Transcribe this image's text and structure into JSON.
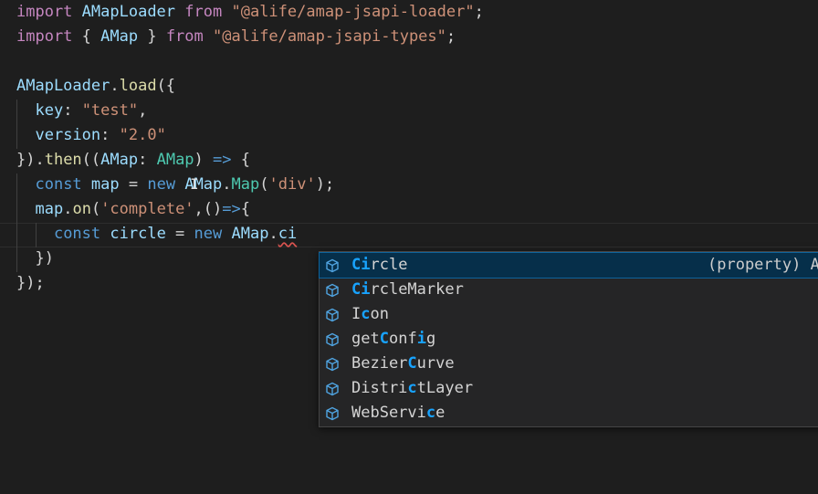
{
  "editor": {
    "lines": [
      [
        {
          "t": "import",
          "c": "kw"
        },
        {
          "t": " ",
          "c": "punc"
        },
        {
          "t": "AMapLoader",
          "c": "var"
        },
        {
          "t": " ",
          "c": "punc"
        },
        {
          "t": "from",
          "c": "kw"
        },
        {
          "t": " ",
          "c": "punc"
        },
        {
          "t": "\"@alife/amap-jsapi-loader\"",
          "c": "str"
        },
        {
          "t": ";",
          "c": "punc"
        }
      ],
      [
        {
          "t": "import",
          "c": "kw"
        },
        {
          "t": " { ",
          "c": "punc"
        },
        {
          "t": "AMap",
          "c": "var"
        },
        {
          "t": " } ",
          "c": "punc"
        },
        {
          "t": "from",
          "c": "kw"
        },
        {
          "t": " ",
          "c": "punc"
        },
        {
          "t": "\"@alife/amap-jsapi-types\"",
          "c": "str"
        },
        {
          "t": ";",
          "c": "punc"
        }
      ],
      [],
      [
        {
          "t": "AMapLoader",
          "c": "var"
        },
        {
          "t": ".",
          "c": "punc"
        },
        {
          "t": "load",
          "c": "fn"
        },
        {
          "t": "({",
          "c": "punc"
        }
      ],
      [
        {
          "t": "  ",
          "c": "punc"
        },
        {
          "t": "key",
          "c": "var"
        },
        {
          "t": ": ",
          "c": "punc"
        },
        {
          "t": "\"test\"",
          "c": "str"
        },
        {
          "t": ",",
          "c": "punc"
        }
      ],
      [
        {
          "t": "  ",
          "c": "punc"
        },
        {
          "t": "version",
          "c": "var"
        },
        {
          "t": ": ",
          "c": "punc"
        },
        {
          "t": "\"2.0\"",
          "c": "str"
        }
      ],
      [
        {
          "t": "}).",
          "c": "punc"
        },
        {
          "t": "then",
          "c": "fn"
        },
        {
          "t": "((",
          "c": "punc"
        },
        {
          "t": "AMap",
          "c": "var"
        },
        {
          "t": ": ",
          "c": "punc"
        },
        {
          "t": "AMap",
          "c": "type"
        },
        {
          "t": ") ",
          "c": "punc"
        },
        {
          "t": "=>",
          "c": "blue"
        },
        {
          "t": " {",
          "c": "punc"
        }
      ],
      [
        {
          "t": "  ",
          "c": "punc"
        },
        {
          "t": "const",
          "c": "blue"
        },
        {
          "t": " ",
          "c": "punc"
        },
        {
          "t": "map",
          "c": "var"
        },
        {
          "t": " = ",
          "c": "punc"
        },
        {
          "t": "new",
          "c": "blue"
        },
        {
          "t": " ",
          "c": "punc"
        },
        {
          "t": "AMap",
          "c": "var"
        },
        {
          "t": ".",
          "c": "punc"
        },
        {
          "t": "Map",
          "c": "type"
        },
        {
          "t": "(",
          "c": "punc"
        },
        {
          "t": "'div'",
          "c": "str"
        },
        {
          "t": ");",
          "c": "punc"
        }
      ],
      [
        {
          "t": "  ",
          "c": "punc"
        },
        {
          "t": "map",
          "c": "var"
        },
        {
          "t": ".",
          "c": "punc"
        },
        {
          "t": "on",
          "c": "fn"
        },
        {
          "t": "(",
          "c": "punc"
        },
        {
          "t": "'complete'",
          "c": "str"
        },
        {
          "t": ",()",
          "c": "punc"
        },
        {
          "t": "=>",
          "c": "blue"
        },
        {
          "t": "{",
          "c": "punc"
        }
      ],
      [
        {
          "t": "    ",
          "c": "punc"
        },
        {
          "t": "const",
          "c": "blue"
        },
        {
          "t": " ",
          "c": "punc"
        },
        {
          "t": "circle",
          "c": "var"
        },
        {
          "t": " = ",
          "c": "punc"
        },
        {
          "t": "new",
          "c": "blue"
        },
        {
          "t": " ",
          "c": "punc"
        },
        {
          "t": "AMap",
          "c": "var"
        },
        {
          "t": ".",
          "c": "punc"
        },
        {
          "t": "ci",
          "c": "var squiggle"
        }
      ],
      [
        {
          "t": "  ",
          "c": "punc"
        },
        {
          "t": "})",
          "c": "punc"
        }
      ],
      [
        {
          "t": "});",
          "c": "punc"
        }
      ]
    ]
  },
  "suggest": {
    "items": [
      {
        "segments": [
          {
            "t": "Ci",
            "hl": true
          },
          {
            "t": "rcle",
            "hl": false
          }
        ],
        "detail": "(property) AMapI",
        "selected": true
      },
      {
        "segments": [
          {
            "t": "Ci",
            "hl": true
          },
          {
            "t": "rcleMarker",
            "hl": false
          }
        ],
        "detail": "",
        "selected": false
      },
      {
        "segments": [
          {
            "t": "I",
            "hl": false
          },
          {
            "t": "c",
            "hl": true
          },
          {
            "t": "on",
            "hl": false
          }
        ],
        "detail": "",
        "selected": false
      },
      {
        "segments": [
          {
            "t": "get",
            "hl": false
          },
          {
            "t": "C",
            "hl": true
          },
          {
            "t": "onf",
            "hl": false
          },
          {
            "t": "i",
            "hl": true
          },
          {
            "t": "g",
            "hl": false
          }
        ],
        "detail": "",
        "selected": false
      },
      {
        "segments": [
          {
            "t": "Bezier",
            "hl": false
          },
          {
            "t": "C",
            "hl": true
          },
          {
            "t": "urve",
            "hl": false
          }
        ],
        "detail": "",
        "selected": false
      },
      {
        "segments": [
          {
            "t": "Distri",
            "hl": false
          },
          {
            "t": "c",
            "hl": true
          },
          {
            "t": "tLayer",
            "hl": false
          }
        ],
        "detail": "",
        "selected": false
      },
      {
        "segments": [
          {
            "t": "WebServi",
            "hl": false
          },
          {
            "t": "c",
            "hl": true
          },
          {
            "t": "e",
            "hl": false
          }
        ],
        "detail": "",
        "selected": false
      }
    ],
    "icon": "cube-property-icon",
    "icon_color": "#4fa3e0"
  }
}
